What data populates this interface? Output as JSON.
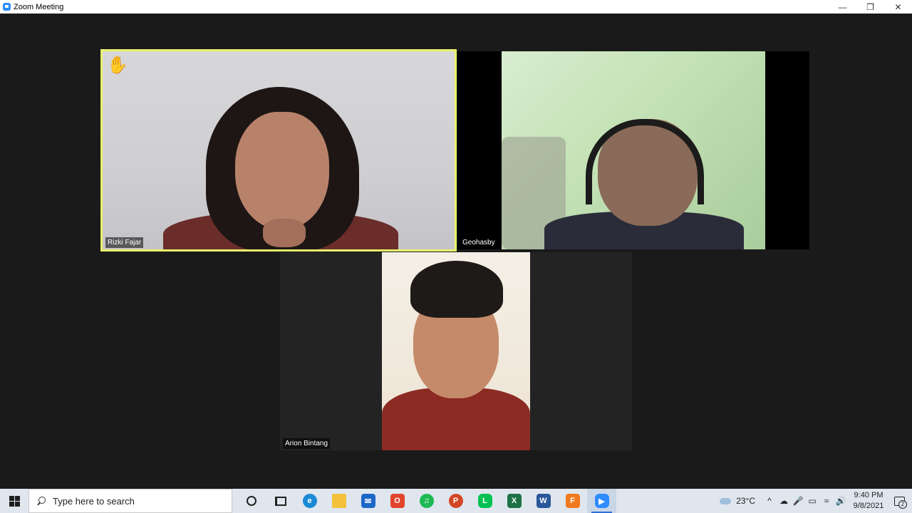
{
  "window": {
    "title": "Zoom Meeting",
    "controls": {
      "minimize": "—",
      "restore": "❐",
      "close": "✕"
    }
  },
  "participants": [
    {
      "name": "Rizki Fajar",
      "raised_hand": "✋",
      "active_speaker": true
    },
    {
      "name": "Geohasby",
      "active_speaker": false
    },
    {
      "name": "Arion Bintang",
      "active_speaker": false
    }
  ],
  "taskbar": {
    "search_placeholder": "Type here to search",
    "apps": [
      {
        "name": "cortana",
        "label": ""
      },
      {
        "name": "task-view",
        "label": ""
      },
      {
        "name": "edge",
        "label": "e",
        "color": "#1b8ad6"
      },
      {
        "name": "file-explorer",
        "label": "",
        "color": "#f3c13a"
      },
      {
        "name": "mail",
        "label": "✉",
        "color": "#1d67c9"
      },
      {
        "name": "office",
        "label": "O",
        "color": "#e2452b"
      },
      {
        "name": "spotify",
        "label": "♫",
        "color": "#1db954"
      },
      {
        "name": "powerpoint",
        "label": "P",
        "color": "#d24726"
      },
      {
        "name": "line",
        "label": "L",
        "color": "#06c152"
      },
      {
        "name": "excel",
        "label": "X",
        "color": "#1e7145"
      },
      {
        "name": "word",
        "label": "W",
        "color": "#2b579a"
      },
      {
        "name": "foxit",
        "label": "F",
        "color": "#f07b1f"
      },
      {
        "name": "zoom",
        "label": "▶",
        "color": "#2d8cff",
        "active": true
      }
    ],
    "weather_temp": "23°C",
    "tray_glyphs": [
      "^",
      "☁",
      "🎤",
      "▭",
      "≈",
      "🔊"
    ],
    "time": "9:40 PM",
    "date": "9/8/2021",
    "notification_count": "2"
  }
}
